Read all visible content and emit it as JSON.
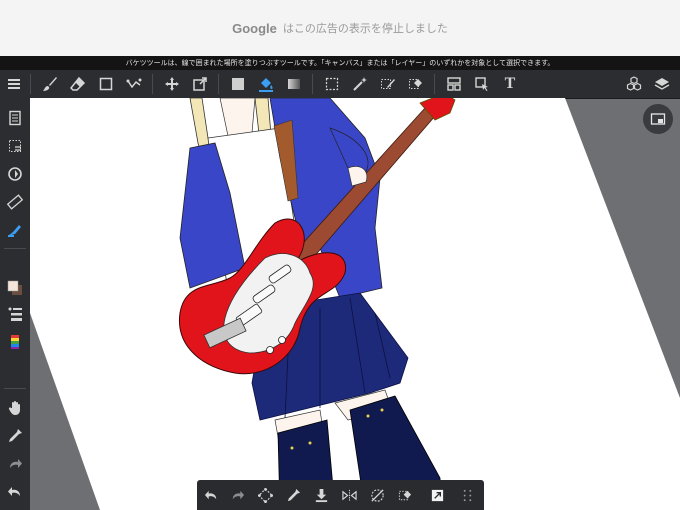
{
  "ad_banner": {
    "brand": "Google",
    "message": "はこの広告の表示を停止しました"
  },
  "tool_hint": "バケツツールは、線で囲まれた場所を塗りつぶすツールです。「キャンバス」または「レイヤー」のいずれかを対象として選択できます。",
  "colors": {
    "toolbar_bg": "#2c2d30",
    "active_tool": "#3a9ef5",
    "icon": "#d6d6d6",
    "skirt": "#1d2a7a",
    "hoodie": "#3a46c8",
    "guitar_body": "#e1141b",
    "socks": "#101a4f"
  },
  "toolbar": {
    "menu": "menu-icon",
    "active_tool": "bucket-tool",
    "text_tool_glyph": "T"
  }
}
